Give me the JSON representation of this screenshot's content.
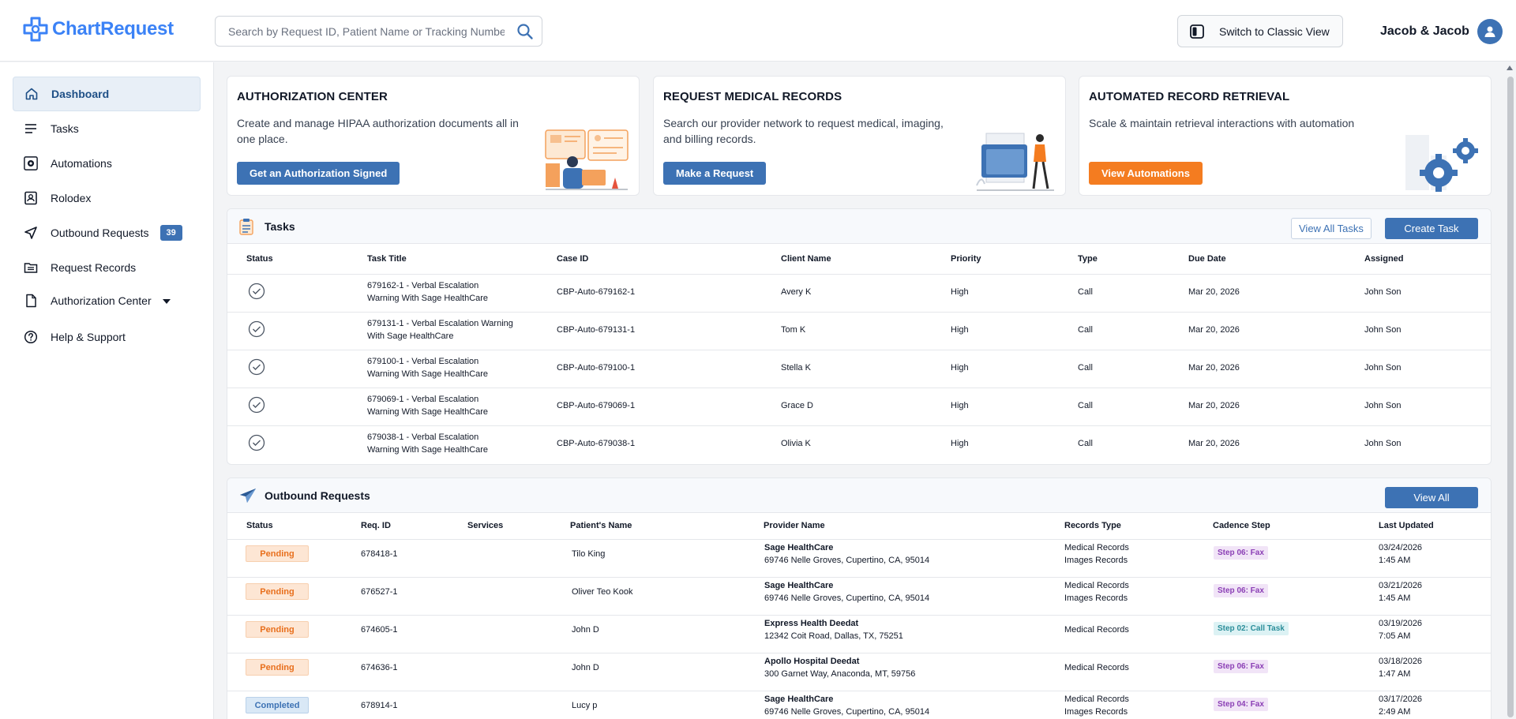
{
  "header": {
    "logo_text": "ChartRequest",
    "search_placeholder": "Search by Request ID, Patient Name or Tracking Number",
    "classic_view_label": "Switch to Classic View",
    "user_name": "Jacob & Jacob"
  },
  "sidebar": {
    "items": [
      {
        "label": "Dashboard",
        "icon": "home-icon"
      },
      {
        "label": "Tasks",
        "icon": "lines-icon"
      },
      {
        "label": "Automations",
        "icon": "gear-icon"
      },
      {
        "label": "Rolodex",
        "icon": "contact-card-icon"
      },
      {
        "label": "Outbound Requests",
        "icon": "send-icon",
        "badge": "39"
      },
      {
        "label": "Request Records",
        "icon": "folder-icon"
      },
      {
        "label": "Authorization Center",
        "icon": "document-icon"
      },
      {
        "label": "Help & Support",
        "icon": "help-icon"
      }
    ]
  },
  "cards": [
    {
      "title": "AUTHORIZATION CENTER",
      "desc": "Create and manage HIPAA authorization documents all in one place.",
      "button": "Get an Authorization Signed"
    },
    {
      "title": "REQUEST MEDICAL RECORDS",
      "desc": "Search our provider network to request medical, imaging, and billing records.",
      "button": "Make a Request"
    },
    {
      "title": "AUTOMATED RECORD RETRIEVAL",
      "desc": "Scale & maintain retrieval interactions with automation",
      "button": "View Automations"
    }
  ],
  "tasks": {
    "title": "Tasks",
    "view_all_label": "View All Tasks",
    "create_label": "Create Task",
    "columns": [
      "Status",
      "Task Title",
      "Case ID",
      "Client Name",
      "Priority",
      "Type",
      "Due Date",
      "Assigned"
    ],
    "rows": [
      {
        "title_l1": "679162-1 - Verbal Escalation",
        "title_l2": "Warning With Sage HealthCare",
        "case_id": "CBP-Auto-679162-1",
        "client": "Avery K",
        "priority": "High",
        "type": "Call",
        "due": "Mar 20, 2026",
        "assigned": "John Son"
      },
      {
        "title_l1": "679131-1 - Verbal Escalation Warning",
        "title_l2": "With Sage HealthCare",
        "case_id": "CBP-Auto-679131-1",
        "client": "Tom K",
        "priority": "High",
        "type": "Call",
        "due": "Mar 20, 2026",
        "assigned": "John Son"
      },
      {
        "title_l1": "679100-1 - Verbal Escalation",
        "title_l2": "Warning With Sage HealthCare",
        "case_id": "CBP-Auto-679100-1",
        "client": "Stella K",
        "priority": "High",
        "type": "Call",
        "due": "Mar 20, 2026",
        "assigned": "John Son"
      },
      {
        "title_l1": "679069-1 - Verbal Escalation",
        "title_l2": "Warning With Sage HealthCare",
        "case_id": "CBP-Auto-679069-1",
        "client": "Grace D",
        "priority": "High",
        "type": "Call",
        "due": "Mar 20, 2026",
        "assigned": "John Son"
      },
      {
        "title_l1": "679038-1 - Verbal Escalation",
        "title_l2": "Warning With Sage HealthCare",
        "case_id": "CBP-Auto-679038-1",
        "client": "Olivia K",
        "priority": "High",
        "type": "Call",
        "due": "Mar 20, 2026",
        "assigned": "John Son"
      }
    ]
  },
  "outbound": {
    "title": "Outbound Requests",
    "view_all_label": "View All",
    "columns": [
      "Status",
      "Req. ID",
      "Services",
      "Patient's Name",
      "Provider Name",
      "Records Type",
      "Cadence Step",
      "Last Updated"
    ],
    "rows": [
      {
        "status": "Pending",
        "req_id": "678418-1",
        "patient": "Tilo King",
        "provider": "Sage HealthCare",
        "address": "69746 Nelle Groves, Cupertino, CA, 95014",
        "records_l1": "Medical Records",
        "records_l2": "Images Records",
        "step": "Step 06: Fax",
        "date": "03/24/2026",
        "time": "1:45 AM"
      },
      {
        "status": "Pending",
        "req_id": "676527-1",
        "patient": "Oliver Teo Kook",
        "provider": "Sage HealthCare",
        "address": "69746 Nelle Groves, Cupertino, CA, 95014",
        "records_l1": "Medical Records",
        "records_l2": "Images Records",
        "step": "Step 06: Fax",
        "date": "03/21/2026",
        "time": "1:45 AM"
      },
      {
        "status": "Pending",
        "req_id": "674605-1",
        "patient": "John D",
        "provider": "Express Health Deedat",
        "address": "12342 Coit Road, Dallas, TX, 75251",
        "records_l1": "Medical Records",
        "records_l2": "",
        "step": "Step 02: Call Task",
        "date": "03/19/2026",
        "time": "7:05 AM"
      },
      {
        "status": "Pending",
        "req_id": "674636-1",
        "patient": "John D",
        "provider": "Apollo Hospital Deedat",
        "address": "300 Garnet Way, Anaconda, MT, 59756",
        "records_l1": "Medical Records",
        "records_l2": "",
        "step": "Step 06: Fax",
        "date": "03/18/2026",
        "time": "1:47 AM"
      },
      {
        "status": "Completed",
        "req_id": "678914-1",
        "patient": "Lucy p",
        "provider": "Sage HealthCare",
        "address": "69746 Nelle Groves, Cupertino, CA, 95014",
        "records_l1": "Medical Records",
        "records_l2": "Images Records",
        "step": "Step 04: Fax",
        "date": "03/17/2026",
        "time": "2:49 AM"
      }
    ]
  },
  "colors": {
    "brand_blue": "#3d72b4",
    "accent_orange": "#f47c20",
    "logo_blue": "#3b82f6"
  }
}
